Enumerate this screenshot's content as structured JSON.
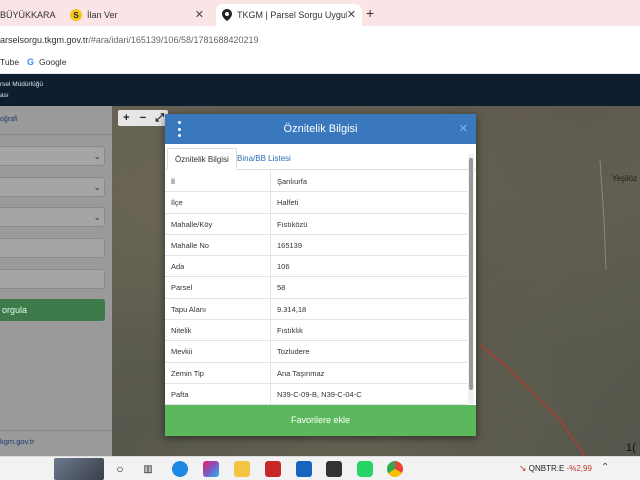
{
  "browser": {
    "tabs": [
      {
        "label": "BÜYÜKKARA",
        "fav": "",
        "fav_color": "#c0392b"
      },
      {
        "label": "İlan Ver",
        "fav": "S",
        "fav_color": "#f5c518"
      },
      {
        "label": "TKGM | Parsel Sorgu Uygulama",
        "fav": "",
        "fav_color": "#222"
      }
    ],
    "new_tab": "+",
    "url_host": "arselsorgu.tkgm.gov.tr",
    "url_path": "/#ara/idari/165139/106/58/1781688420219",
    "bookmarks": [
      "Tube",
      "Google"
    ]
  },
  "site": {
    "header_line1": "rsel Müdürlüğü",
    "header_line2": "ası",
    "sidebar_link": "oğrafi",
    "search_button": "orgula",
    "footer": "kgm.gov.tr"
  },
  "map": {
    "place_label": "Yeşilöz",
    "tools": [
      "+",
      "−",
      "⤢"
    ]
  },
  "modal": {
    "title": "Öznitelik Bilgisi",
    "close": "✕",
    "tabs": [
      "Öznitelik Bilgisi",
      "Bina/BB Listesi"
    ],
    "rows": [
      {
        "k": "İl",
        "v": "Şanlıurfa"
      },
      {
        "k": "İlçe",
        "v": "Halfeti"
      },
      {
        "k": "Mahalle/Köy",
        "v": "Fıstıközü"
      },
      {
        "k": "Mahalle No",
        "v": "165139"
      },
      {
        "k": "Ada",
        "v": "106"
      },
      {
        "k": "Parsel",
        "v": "58"
      },
      {
        "k": "Tapu Alanı",
        "v": "9.314,18"
      },
      {
        "k": "Nitelik",
        "v": "Fıstıklık"
      },
      {
        "k": "Mevkii",
        "v": "Tozludere"
      },
      {
        "k": "Zemin Tip",
        "v": "Ana Taşınmaz"
      },
      {
        "k": "Pafta",
        "v": "N39-C-09-B, N39-C-04-C"
      }
    ],
    "favorite_button": "Favorilere ekle"
  },
  "taskbar": {
    "ticker_symbol": "QNBTR.E",
    "ticker_change": "-%2,99",
    "corner_number": "1("
  }
}
